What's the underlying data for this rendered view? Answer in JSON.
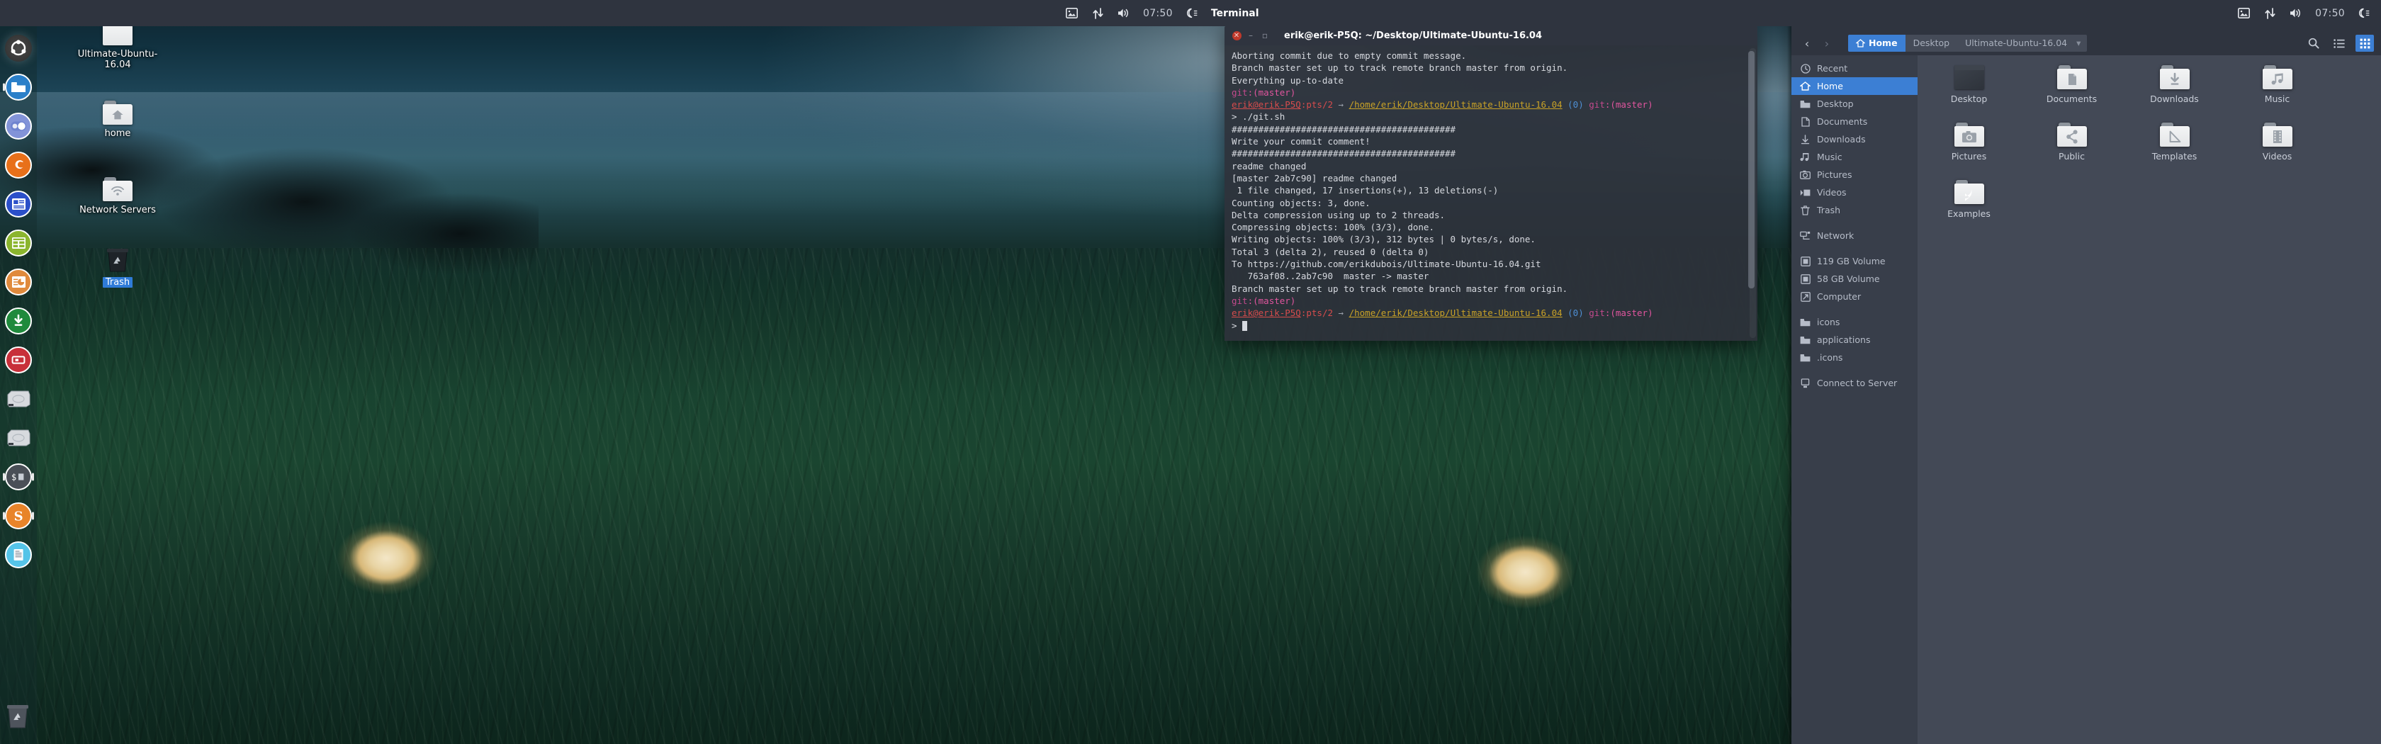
{
  "top_panel": {
    "center_tray": {
      "icons": [
        "image-icon",
        "network-updown-icon",
        "volume-icon"
      ],
      "clock": "07:50",
      "power_icon": "power-moon-icon",
      "app_title": "Terminal"
    },
    "right_tray": {
      "icons": [
        "image-icon",
        "network-updown-icon",
        "volume-icon"
      ],
      "clock": "07:50",
      "power_icon": "power-moon-icon"
    }
  },
  "dock": {
    "items": [
      {
        "name": "ubuntu-dash-icon",
        "label": "Ubuntu",
        "color": "#3b3b3b"
      },
      {
        "name": "files-icon",
        "label": "Files",
        "color": "#2a7fc9"
      },
      {
        "name": "settings-icon",
        "label": "System Settings",
        "color": "#7b8fd4"
      },
      {
        "name": "firefox-icon",
        "label": "Firefox",
        "color": "#e8701a"
      },
      {
        "name": "libreoffice-writer-icon",
        "label": "LibreOffice Writer",
        "color": "#2b4fc9"
      },
      {
        "name": "libreoffice-calc-icon",
        "label": "LibreOffice Calc",
        "color": "#7fa72b"
      },
      {
        "name": "libreoffice-impress-icon",
        "label": "LibreOffice Impress",
        "color": "#e08a3c"
      },
      {
        "name": "software-updater-icon",
        "label": "Software Updater",
        "color": "#1f8a3c"
      },
      {
        "name": "help-icon",
        "label": "Ubuntu Help",
        "color": "#c8303a"
      },
      {
        "name": "disk-119gb-icon",
        "label": "119 GB Volume",
        "color": "#c6cbd2"
      },
      {
        "name": "disk-58gb-icon",
        "label": "58 GB Volume",
        "color": "#c6cbd2"
      },
      {
        "name": "terminal-icon",
        "label": "Terminal",
        "color": "#4a4f57"
      },
      {
        "name": "sublime-text-icon",
        "label": "Sublime Text",
        "color": "#e8842a"
      },
      {
        "name": "text-editor-icon",
        "label": "Text Editor",
        "color": "#55c4e8"
      }
    ],
    "trash": {
      "name": "trash-icon",
      "label": "Trash"
    }
  },
  "desktop_icons": [
    {
      "name": "desktop-icon-ultimate-ubuntu",
      "label": "Ultimate-Ubuntu-16.04",
      "glyph": "none",
      "selected": false
    },
    {
      "name": "desktop-icon-home",
      "label": "home",
      "glyph": "home",
      "selected": false
    },
    {
      "name": "desktop-icon-network-servers",
      "label": "Network Servers",
      "glyph": "network",
      "selected": false
    },
    {
      "name": "desktop-icon-trash",
      "label": "Trash",
      "glyph": "trash",
      "selected": true
    }
  ],
  "terminal": {
    "title": "erik@erik-P5Q: ~/Desktop/Ultimate-Ubuntu-16.04",
    "close_glyph": "✕",
    "min_glyph": "–",
    "max_glyph": "▫",
    "lines": [
      {
        "type": "plain",
        "text": "Aborting commit due to empty commit message."
      },
      {
        "type": "plain",
        "text": "Branch master set up to track remote branch master from origin."
      },
      {
        "type": "plain",
        "text": "Everything up-to-date"
      },
      {
        "type": "gitline",
        "git": "git",
        "colon": ":(",
        "branch": "master",
        "close": ")"
      },
      {
        "type": "prompt",
        "user": "erik@erik-P5Q",
        "sep": ":",
        "tty": "pts/2",
        "arrow": " → ",
        "path": "/home/erik/Desktop/Ultimate-Ubuntu-16.04",
        "code": "(0)",
        "git": "git",
        "colon": ":(",
        "branch": "master",
        "close": ")"
      },
      {
        "type": "cmd",
        "caret": "> ",
        "text": "./git.sh"
      },
      {
        "type": "plain",
        "text": "##########################################"
      },
      {
        "type": "plain",
        "text": "Write your commit comment!"
      },
      {
        "type": "plain",
        "text": "##########################################"
      },
      {
        "type": "plain",
        "text": "readme changed"
      },
      {
        "type": "plain",
        "text": "[master 2ab7c90] readme changed"
      },
      {
        "type": "plain",
        "text": " 1 file changed, 17 insertions(+), 13 deletions(-)"
      },
      {
        "type": "plain",
        "text": "Counting objects: 3, done."
      },
      {
        "type": "plain",
        "text": "Delta compression using up to 2 threads."
      },
      {
        "type": "plain",
        "text": "Compressing objects: 100% (3/3), done."
      },
      {
        "type": "plain",
        "text": "Writing objects: 100% (3/3), 312 bytes | 0 bytes/s, done."
      },
      {
        "type": "plain",
        "text": "Total 3 (delta 2), reused 0 (delta 0)"
      },
      {
        "type": "plain",
        "text": "To https://github.com/erikdubois/Ultimate-Ubuntu-16.04.git"
      },
      {
        "type": "plain",
        "text": "   763af08..2ab7c90  master -> master"
      },
      {
        "type": "plain",
        "text": "Branch master set up to track remote branch master from origin."
      },
      {
        "type": "gitline",
        "git": "git",
        "colon": ":(",
        "branch": "master",
        "close": ")"
      },
      {
        "type": "prompt",
        "user": "erik@erik-P5Q",
        "sep": ":",
        "tty": "pts/2",
        "arrow": " → ",
        "path": "/home/erik/Desktop/Ultimate-Ubuntu-16.04",
        "code": "(0)",
        "git": "git",
        "colon": ":(",
        "branch": "master",
        "close": ")"
      },
      {
        "type": "cursor",
        "caret": "> "
      }
    ]
  },
  "filemanager": {
    "title": "Home",
    "close_glyph": "✕",
    "min_glyph": "–",
    "max_glyph": "▫",
    "nav": {
      "back_glyph": "‹",
      "forward_glyph": "›"
    },
    "breadcrumb": [
      {
        "label": "Home",
        "active": true,
        "icon": "home-icon"
      },
      {
        "label": "Desktop",
        "active": false
      },
      {
        "label": "Ultimate-Ubuntu-16.04",
        "active": false
      }
    ],
    "toolbar_right": [
      {
        "name": "search-icon",
        "active": false
      },
      {
        "name": "list-view-icon",
        "active": false
      },
      {
        "name": "grid-view-icon",
        "active": true
      }
    ],
    "sidebar": [
      {
        "label": "Recent",
        "icon": "clock-icon",
        "active": false,
        "sep_after": false
      },
      {
        "label": "Home",
        "icon": "home-icon",
        "active": true,
        "sep_after": false
      },
      {
        "label": "Desktop",
        "icon": "folder-icon",
        "active": false,
        "sep_after": false
      },
      {
        "label": "Documents",
        "icon": "document-icon",
        "active": false,
        "sep_after": false
      },
      {
        "label": "Downloads",
        "icon": "download-icon",
        "active": false,
        "sep_after": false
      },
      {
        "label": "Music",
        "icon": "music-icon",
        "active": false,
        "sep_after": false
      },
      {
        "label": "Pictures",
        "icon": "camera-icon",
        "active": false,
        "sep_after": false
      },
      {
        "label": "Videos",
        "icon": "video-icon",
        "active": false,
        "sep_after": false
      },
      {
        "label": "Trash",
        "icon": "trash-icon",
        "active": false,
        "sep_after": true
      },
      {
        "label": "Network",
        "icon": "network-icon",
        "active": false,
        "sep_after": true
      },
      {
        "label": "119 GB Volume",
        "icon": "drive-icon",
        "active": false,
        "sep_after": false
      },
      {
        "label": "58 GB Volume",
        "icon": "drive-icon",
        "active": false,
        "sep_after": false
      },
      {
        "label": "Computer",
        "icon": "computer-icon",
        "active": false,
        "sep_after": true
      },
      {
        "label": "icons",
        "icon": "folder-icon",
        "active": false,
        "sep_after": false
      },
      {
        "label": "applications",
        "icon": "folder-icon",
        "active": false,
        "sep_after": false
      },
      {
        "label": ".icons",
        "icon": "folder-icon",
        "active": false,
        "sep_after": true
      },
      {
        "label": "Connect to Server",
        "icon": "server-icon",
        "active": false,
        "sep_after": false
      }
    ],
    "files": [
      {
        "label": "Desktop",
        "icon": "desktop-window-icon"
      },
      {
        "label": "Documents",
        "icon": "document-folder-icon"
      },
      {
        "label": "Downloads",
        "icon": "download-folder-icon"
      },
      {
        "label": "Music",
        "icon": "music-folder-icon"
      },
      {
        "label": "Pictures",
        "icon": "pictures-folder-icon"
      },
      {
        "label": "Public",
        "icon": "public-folder-icon"
      },
      {
        "label": "Templates",
        "icon": "templates-folder-icon"
      },
      {
        "label": "Videos",
        "icon": "videos-folder-icon"
      },
      {
        "label": "Examples",
        "icon": "link-folder-icon"
      }
    ]
  },
  "colors": {
    "panel_bg": "#2f343f",
    "accent_blue": "#3c7fd4",
    "window_bg": "#383e4a",
    "content_bg": "#434956",
    "terminal_bg": "#2d323a"
  }
}
